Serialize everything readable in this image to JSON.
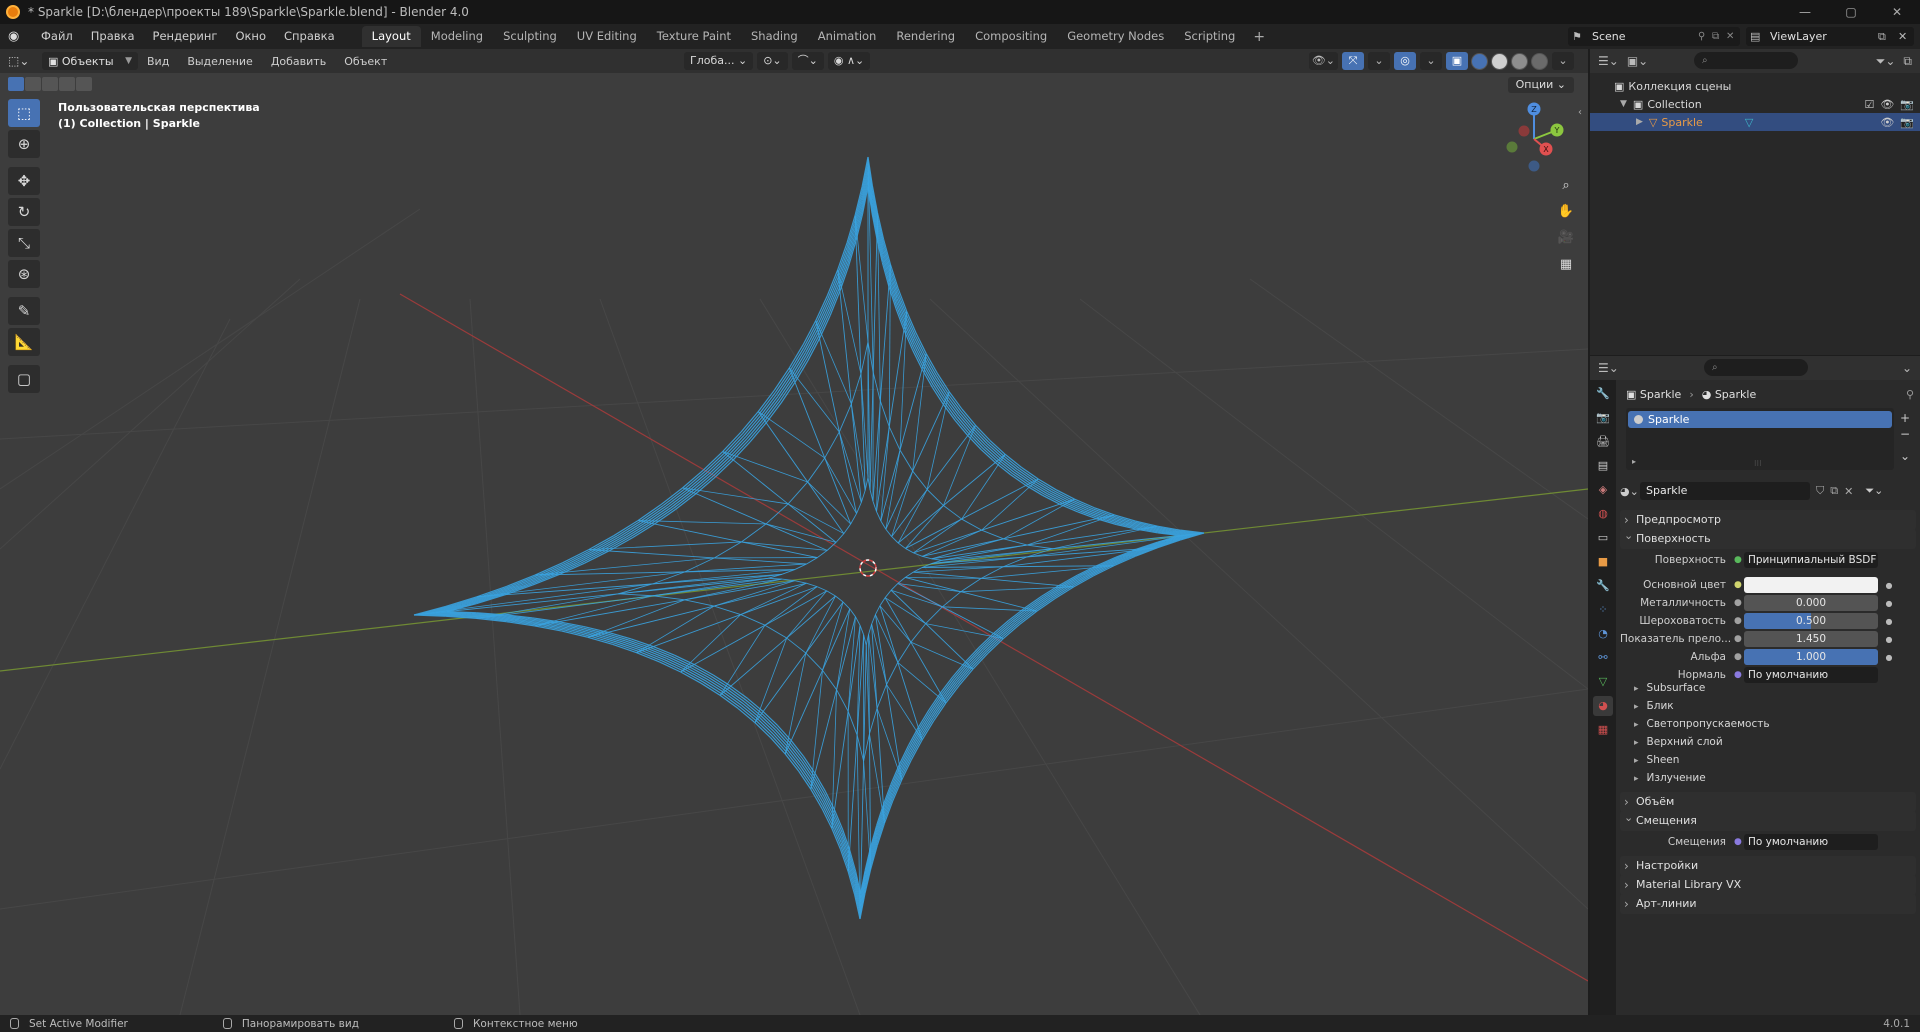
{
  "window": {
    "title": "* Sparkle [D:\\блендер\\проекты 189\\Sparkle\\Sparkle.blend] - Blender 4.0",
    "minimize": "—",
    "maximize": "▢",
    "close": "✕"
  },
  "menu": {
    "items": [
      "Файл",
      "Правка",
      "Рендеринг",
      "Окно",
      "Справка"
    ]
  },
  "workspaces": {
    "tabs": [
      "Layout",
      "Modeling",
      "Sculpting",
      "UV Editing",
      "Texture Paint",
      "Shading",
      "Animation",
      "Rendering",
      "Compositing",
      "Geometry Nodes",
      "Scripting"
    ],
    "active": "Layout",
    "add": "+"
  },
  "scene": {
    "name": "Scene"
  },
  "view_layer": {
    "name": "ViewLayer"
  },
  "viewport": {
    "mode": "Объекты",
    "menus": [
      "Вид",
      "Выделение",
      "Добавить",
      "Объект"
    ],
    "orientation": "Глоба...",
    "options": "Опции",
    "info_line1": "Пользовательская перспектива",
    "info_line2": "(1) Collection | Sparkle",
    "wire_color": "#3aa3e0",
    "gizmo": {
      "z": "Z",
      "x": "X",
      "y": "Y"
    }
  },
  "outliner": {
    "search_placeholder": "⌕",
    "root": "Коллекция сцены",
    "collection": "Collection",
    "object": "Sparkle"
  },
  "properties": {
    "search_placeholder": "⌕",
    "breadcrumb_object": "Sparkle",
    "breadcrumb_material": "Sparkle",
    "slot": "Sparkle",
    "material_name": "Sparkle",
    "panels": {
      "preview": "Предпросмотр",
      "surface": "Поверхность",
      "volume": "Объём",
      "displacement": "Смещения",
      "settings": "Настройки",
      "material_library": "Material Library VX",
      "lineart": "Арт-линии"
    },
    "surface": {
      "surface_label": "Поверхность",
      "surface_value": "Принципиальный BSDF",
      "base_color_label": "Основной цвет",
      "metallic_label": "Металличность",
      "metallic_value": "0.000",
      "metallic_fill": 0.0,
      "roughness_label": "Шероховатость",
      "roughness_value": "0.500",
      "roughness_fill": 0.5,
      "ior_label": "Показатель прело...",
      "ior_value": "1.450",
      "ior_fill": 0.0,
      "alpha_label": "Альфа",
      "alpha_value": "1.000",
      "alpha_fill": 1.0,
      "normal_label": "Нормаль",
      "normal_value": "По умолчанию",
      "subpanels": [
        "Subsurface",
        "Блик",
        "Светопропускаемость",
        "Верхний слой",
        "Sheen",
        "Излучение"
      ]
    },
    "displacement": {
      "label": "Смещения",
      "value": "По умолчанию"
    }
  },
  "status": {
    "left": "Set Active Modifier",
    "middle": "Панорамировать вид",
    "right": "Контекстное меню",
    "version": "4.0.1"
  }
}
